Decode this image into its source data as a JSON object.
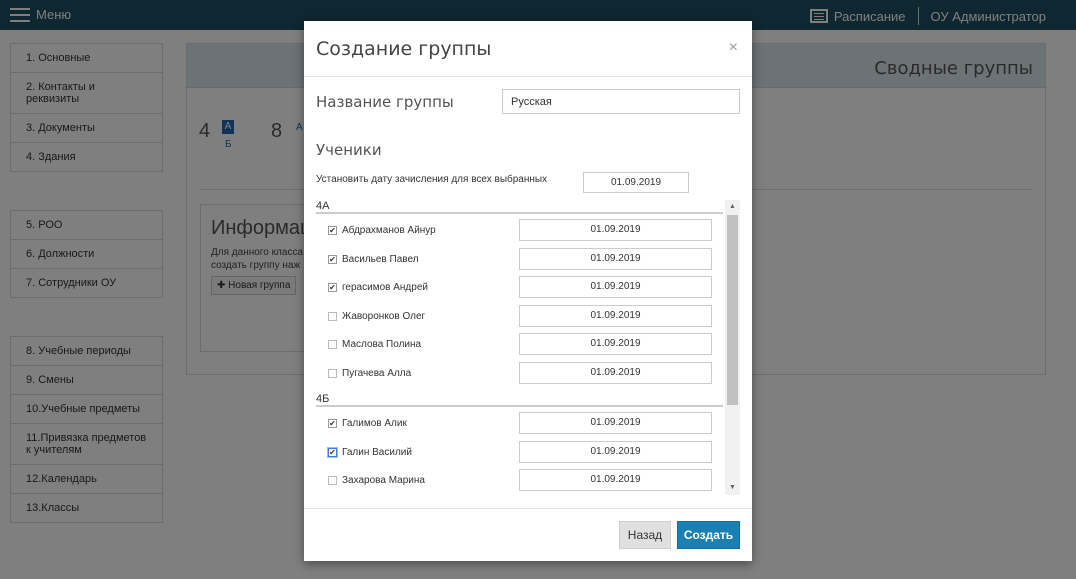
{
  "topbar": {
    "menu_label": "Меню",
    "schedule_label": "Расписание",
    "user_label": "ОУ Администратор"
  },
  "sidebar": {
    "group1": [
      "1. Основные",
      "2. Контакты и реквизиты",
      "3. Документы",
      "4. Здания"
    ],
    "group2": [
      "5. РОО",
      "6. Должности",
      "7. Сотрудники ОУ"
    ],
    "group3": [
      "8. Учебные периоды",
      "9. Смены",
      "10.Учебные предметы",
      "11.Привязка предметов к учителям",
      "12.Календарь",
      "13.Классы"
    ]
  },
  "main": {
    "title": "Сводные группы",
    "class4_num": "4",
    "class4_badge": "А",
    "class4_sub": "Б",
    "class8_num": "8",
    "class8_badge": "А",
    "info_title": "Информация",
    "info_line1": "Для данного класса",
    "info_line2": "создать группу наж",
    "new_group_label": "✚ Новая группа"
  },
  "modal": {
    "title": "Создание группы",
    "close_glyph": "×",
    "name_label": "Название группы",
    "name_value": "Русская",
    "students_title": "Ученики",
    "set_date_label": "Установить дату зачисления для всех выбранных",
    "set_date_value": "01.09.2019",
    "groups": [
      {
        "name": "4А",
        "students": [
          {
            "name": "Абдрахманов Айнур",
            "checked": true,
            "date": "01.09.2019"
          },
          {
            "name": "Васильев Павел",
            "checked": true,
            "date": "01.09.2019"
          },
          {
            "name": "герасимов Андрей",
            "checked": true,
            "date": "01.09.2019"
          },
          {
            "name": "Жаворонков Олег",
            "checked": false,
            "date": "01.09.2019"
          },
          {
            "name": "Маслова Полина",
            "checked": false,
            "date": "01.09.2019"
          },
          {
            "name": "Пугачева Алла",
            "checked": false,
            "date": "01.09.2019"
          }
        ]
      },
      {
        "name": "4Б",
        "students": [
          {
            "name": "Галимов Алик",
            "checked": true,
            "date": "01.09.2019"
          },
          {
            "name": "Галин Василий",
            "checked": true,
            "focused": true,
            "date": "01.09.2019"
          },
          {
            "name": "Захарова Марина",
            "checked": false,
            "date": "01.09.2019"
          }
        ]
      }
    ],
    "back_label": "Назад",
    "create_label": "Создать"
  }
}
